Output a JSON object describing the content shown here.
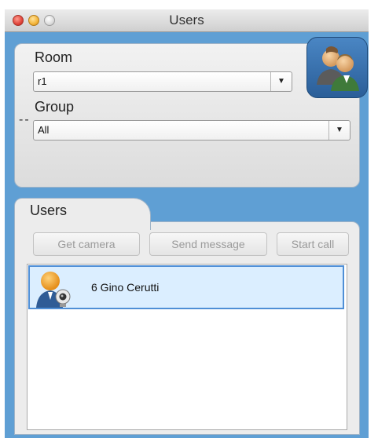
{
  "window": {
    "title": "Users"
  },
  "room": {
    "label": "Room",
    "selected": "r1"
  },
  "group": {
    "label": "Group",
    "selected": "All",
    "status": "--"
  },
  "users_tab": {
    "label": "Users"
  },
  "actions": {
    "get_camera": "Get camera",
    "send_message": "Send message",
    "start_call": "Start call"
  },
  "users": [
    {
      "name": "6 Gino Cerutti",
      "icon": "webcam-user-icon"
    }
  ],
  "icons": {
    "panel": "users-icon",
    "dropdown": "chevron-down-icon"
  },
  "colors": {
    "window_bg": "#5f9fd4",
    "selection_border": "#4f8fd6",
    "selection_fill": "#dbeeff"
  }
}
